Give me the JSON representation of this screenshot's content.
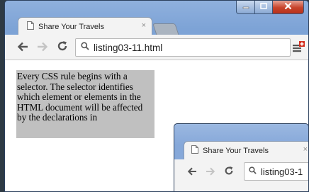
{
  "main_window": {
    "tab": {
      "title": "Share Your Travels",
      "close_glyph": "×",
      "icon": "page-icon"
    },
    "toolbar": {
      "back_icon": "back-arrow-icon",
      "forward_icon": "forward-arrow-icon",
      "reload_icon": "reload-icon",
      "url": "listing03-11.html",
      "search_icon": "search-icon",
      "menu_icon": "menu-icon"
    },
    "content": {
      "paragraph": "Every CSS rule begins with a selector. The selector identifies which element or elements in the HTML document will be affected by the declarations in"
    },
    "caption_buttons": {
      "minimize": "minimize-icon",
      "maximize": "maximize-icon",
      "close": "close-icon"
    }
  },
  "second_window": {
    "tab": {
      "title": "Share Your Travels",
      "close_glyph": "×"
    },
    "toolbar": {
      "url": "listing03-1"
    }
  },
  "colors": {
    "title_bar": "#7da3d6",
    "paragraph_bg": "#c0c0c0",
    "close_button": "#c7432b",
    "menu_badge": "#d32f1f"
  }
}
